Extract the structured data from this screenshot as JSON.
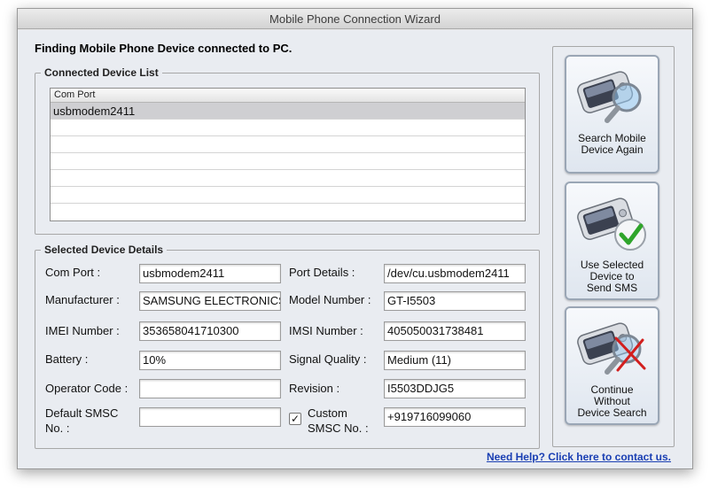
{
  "window": {
    "title": "Mobile Phone Connection Wizard"
  },
  "heading": "Finding Mobile Phone Device connected to PC.",
  "connected_list": {
    "legend": "Connected Device List",
    "column_header": "Com Port",
    "rows": [
      "usbmodem2411",
      "",
      "",
      "",
      "",
      ""
    ],
    "selected_index": 0
  },
  "details": {
    "legend": "Selected Device Details",
    "com_port": {
      "label": "Com Port :",
      "value": "usbmodem2411"
    },
    "manufacturer": {
      "label": "Manufacturer :",
      "value": "SAMSUNG ELECTRONICS"
    },
    "imei_number": {
      "label": "IMEI Number :",
      "value": "353658041710300"
    },
    "battery": {
      "label": "Battery :",
      "value": "10%"
    },
    "operator_code": {
      "label": "Operator Code :",
      "value": ""
    },
    "default_smsc": {
      "label_line1": "Default SMSC",
      "label_line2": "No. :",
      "value": ""
    },
    "port_details": {
      "label": "Port Details :",
      "value": "/dev/cu.usbmodem2411"
    },
    "model_number": {
      "label": "Model Number :",
      "value": "GT-I5503"
    },
    "imsi_number": {
      "label": "IMSI Number :",
      "value": "405050031738481"
    },
    "signal_quality": {
      "label": "Signal Quality :",
      "value": "Medium (11)"
    },
    "revision": {
      "label": "Revision :",
      "value": "I5503DDJG5"
    },
    "custom_smsc": {
      "label_line1": "Custom",
      "label_line2": "SMSC No. :",
      "value": "+919716099060",
      "checked": true
    }
  },
  "buttons": {
    "search_again": {
      "line1": "Search Mobile",
      "line2": "Device Again",
      "icon": "phone-magnifier-icon"
    },
    "use_selected": {
      "line1": "Use Selected",
      "line2": "Device to",
      "line3": "Send SMS",
      "icon": "phone-checkmark-icon"
    },
    "continue_without": {
      "line1": "Continue",
      "line2": "Without",
      "line3": "Device Search",
      "icon": "phone-cross-icon"
    }
  },
  "help_link": "Need Help? Click here to contact us.",
  "colors": {
    "link": "#1a3fb3",
    "selected_row": "#cfcfd2",
    "check": "#2fa52b",
    "cross": "#d21f1f"
  }
}
